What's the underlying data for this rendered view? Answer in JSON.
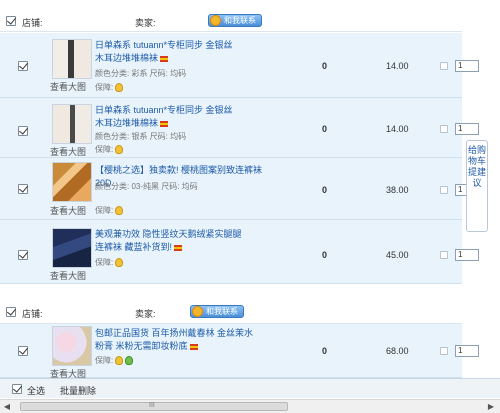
{
  "shops": [
    {
      "shop_label": "店铺:",
      "seller_label": "卖家:",
      "contact_label": "和我联系"
    },
    {
      "shop_label": "店铺:",
      "seller_label": "卖家:",
      "contact_label": "和我联系"
    }
  ],
  "items": [
    {
      "title": "日单森系 tutuann*专柜同步 金银丝木耳边堆堆棉袜",
      "meta": "颜色分类: 彩系   尺码: 均码",
      "guarantee_label": "保障:",
      "view_big": "查看大图",
      "zero": "0",
      "price": "14.00",
      "qty": "1"
    },
    {
      "title": "日单森系 tutuann*专柜同步 金银丝木耳边堆堆棉袜",
      "meta": "颜色分类: 银系   尺码: 均码",
      "guarantee_label": "保障:",
      "view_big": "查看大图",
      "zero": "0",
      "price": "14.00",
      "qty": "1"
    },
    {
      "title": "【樱桃之选】独卖款! 樱桃图案别致连裤袜 20D",
      "meta": "颜色分类: 03-纯黑   尺码: 均码",
      "guarantee_label": "保障:",
      "view_big": "查看大图",
      "zero": "0",
      "price": "38.00",
      "qty": "1"
    },
    {
      "title": "美观兼功效 隐性竖纹天鹅绒紧实腿腿 连裤袜 藏蓝补货到!",
      "meta": "",
      "guarantee_label": "保障:",
      "view_big": "查看大图",
      "zero": "0",
      "price": "45.00",
      "qty": "1"
    },
    {
      "title": "包邮正品国货 百年扬州戴春林 金丝茉水粉膏 米粉无需卸妆粉底",
      "meta": "",
      "guarantee_label": "保障:",
      "view_big": "查看大图",
      "zero": "0",
      "price": "68.00",
      "qty": "1"
    }
  ],
  "side_tab": "给购物车提建议",
  "footer": {
    "select_all": "全选",
    "batch_delete": "批量删除"
  },
  "scroll_grip": "III"
}
